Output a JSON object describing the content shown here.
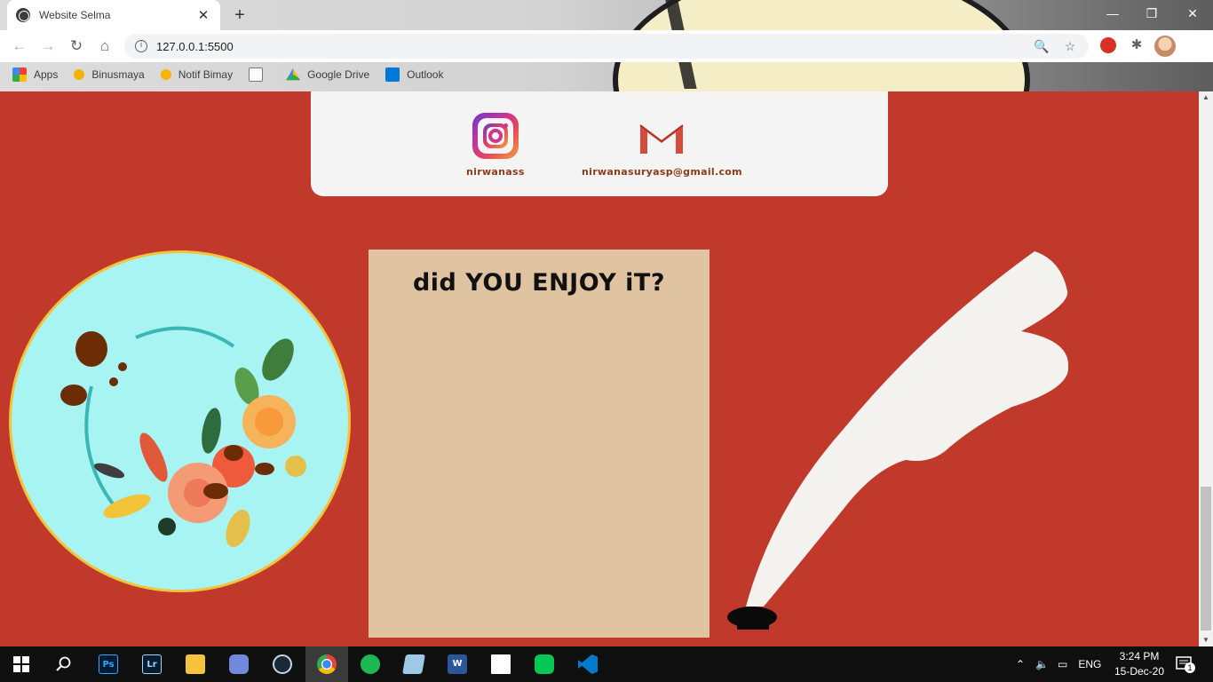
{
  "browser": {
    "tab_title": "Website Selma",
    "tab_close": "✕",
    "new_tab": "+",
    "url": "127.0.0.1:5500",
    "window_controls": {
      "minimize": "—",
      "restore": "❐",
      "close": "✕"
    },
    "nav": {
      "back": "←",
      "forward": "→",
      "reload": "↻",
      "home": "⌂"
    },
    "zoom_icon": "🔍",
    "star_icon": "☆",
    "puzzle_icon": "✱"
  },
  "bookmarks": [
    {
      "label": "Apps",
      "color": "#ea4335"
    },
    {
      "label": "Binusmaya",
      "color": "#f5b400"
    },
    {
      "label": "Notif Bimay",
      "color": "#f5b400"
    },
    {
      "label": "",
      "color": "#777777"
    },
    {
      "label": "Google Drive",
      "color": "#34a853"
    },
    {
      "label": "Outlook",
      "color": "#0078d4"
    }
  ],
  "contacts": {
    "instagram": {
      "label": "nirwanass"
    },
    "email": {
      "label": "nirwanasuryasp@gmail.com"
    }
  },
  "panel": {
    "title": "did YOU ENJOY iT?"
  },
  "colors": {
    "page_bg": "#c0392b",
    "card_bg": "#f4f4f4",
    "panel_bg": "#e0c3a1",
    "circle_bg": "#a7f4f2",
    "circle_border": "#f3c33a",
    "label_color": "#8b3a1a"
  },
  "taskbar": {
    "apps": [
      "windows-start",
      "search",
      "photoshop",
      "lightroom",
      "file-explorer",
      "discord",
      "steam",
      "chrome",
      "spotify",
      "notepad",
      "word",
      "sticky-notes",
      "line",
      "vscode"
    ],
    "app_labels": {
      "photoshop": "Ps",
      "lightroom": "Lr",
      "word": "W"
    },
    "language": "ENG",
    "time": "3:24 PM",
    "date": "15-Dec-20",
    "notifications": "1"
  }
}
